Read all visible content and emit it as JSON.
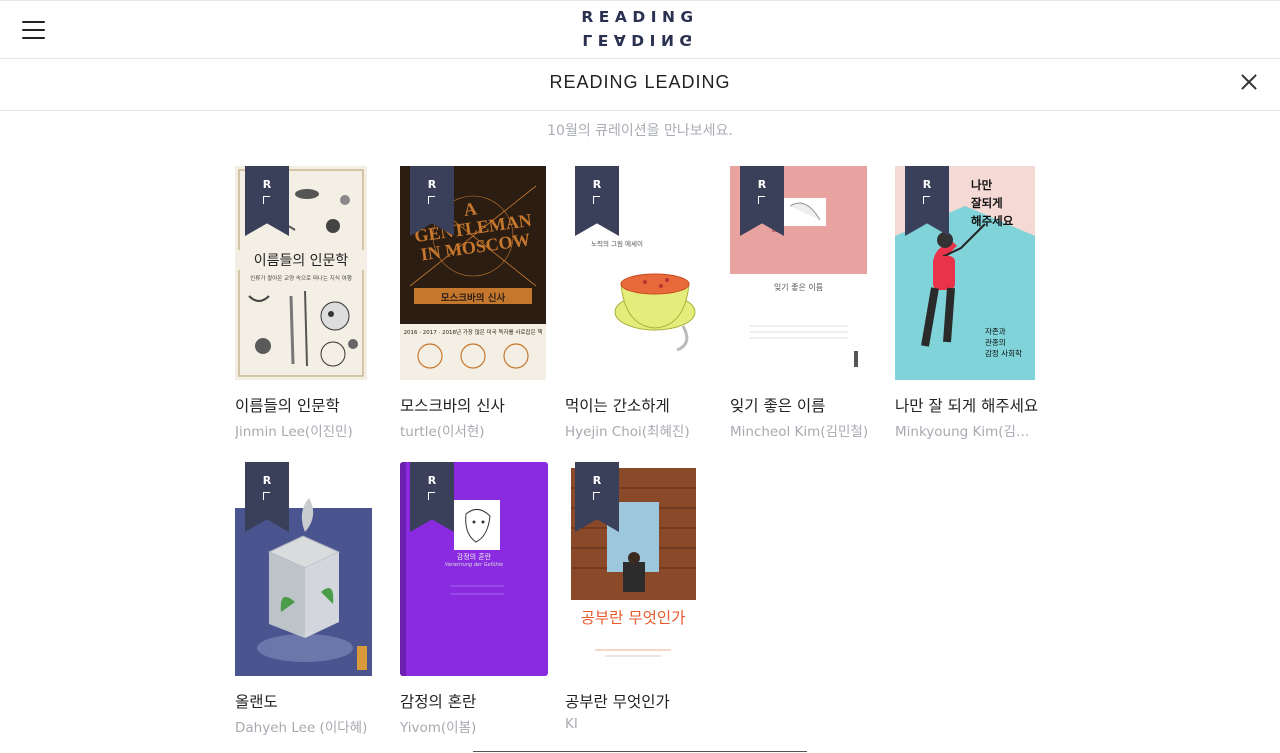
{
  "header": {
    "logo_top": "READING",
    "logo_bottom": "LEADING",
    "title": "READING LEADING"
  },
  "subtitle": "10월의 큐레이션을 만나보세요.",
  "ribbon": {
    "letter": "R"
  },
  "books": [
    {
      "title": "이름들의 인문학",
      "author": "Jinmin Lee(이진민)",
      "cover": {
        "title": "이름들의 인문학",
        "subtitle": "인류가 쌓아온 교양 속으로 떠나는 지식 여행",
        "bg": "#f4efe4"
      }
    },
    {
      "title": "모스크바의 신사",
      "author": "turtle(이서현)",
      "cover": {
        "title_lines": [
          "A",
          "GENTLEMAN",
          "IN MOSCOW"
        ],
        "kr_title": "모스크바의 신사",
        "banner": "2016 · 2017 · 2018년 가장 많은 미국 독자를 사로잡은 책",
        "bg": "#2b1d12",
        "accent": "#c6772e"
      }
    },
    {
      "title": "먹이는 간소하게",
      "author": "Hyejin Choi(최혜진)",
      "cover": {
        "tag": "노력의 그림 에세이",
        "bg": "#ffffff"
      }
    },
    {
      "title": "잊기 좋은 이름",
      "author": "Mincheol Kim(김민철)",
      "cover": {
        "title": "잊기 좋은 이름",
        "bg": "#e8a3a0"
      }
    },
    {
      "title": "나만 잘 되게 해주세요",
      "author": "Minkyoung Kim(김민경)",
      "cover": {
        "title_lines": [
          "나만",
          "잘되게",
          "해주세요"
        ],
        "sub_lines": [
          "자존과",
          "관종의",
          "감정 사회학"
        ],
        "bg": "#f5d9d5",
        "accent": "#7fd3d9"
      }
    },
    {
      "title": "올랜도",
      "author": "Dahyeh Lee (이다혜)",
      "cover": {
        "bg": "#4a5590"
      }
    },
    {
      "title": "감정의 혼란",
      "author": "Yivom(이봄)",
      "cover": {
        "title": "감정의 혼란",
        "subtitle": "Verwirrung der Gefühle",
        "bg": "#8a2be2"
      }
    },
    {
      "title": "공부란 무엇인가",
      "author": "KI",
      "cover": {
        "title": "공부란 무엇인가",
        "bg": "#ffffff",
        "accent": "#e85a2c"
      }
    }
  ],
  "colors": {
    "ribbon": "#3a3f5a",
    "logo": "#2a3050",
    "muted_text": "#a7aab1"
  }
}
